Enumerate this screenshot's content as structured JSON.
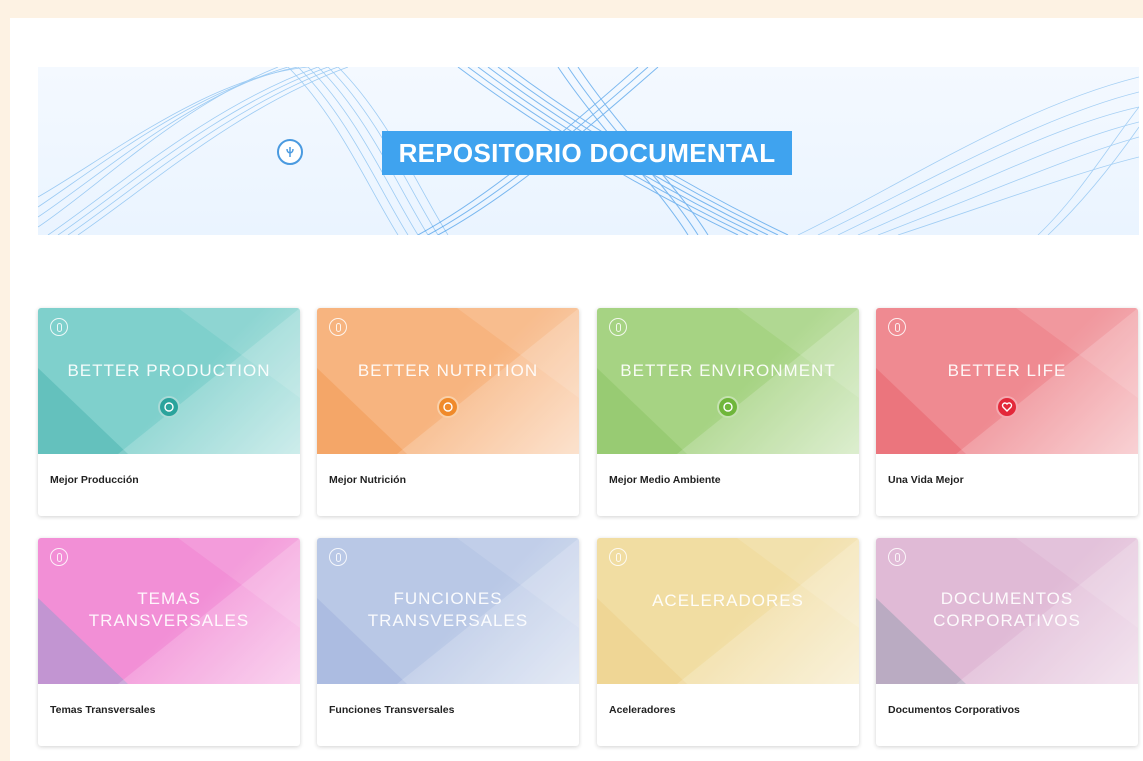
{
  "banner": {
    "title": "REPOSITORIO DOCUMENTAL",
    "logo_icon": "fao-logo-icon",
    "accent_color": "#3fa3ef"
  },
  "cards": [
    {
      "key": "production",
      "heading_lines": [
        "BETTER PRODUCTION"
      ],
      "caption": "Mejor Producción",
      "color": "#7fd0cc",
      "dark": "#4fb5b0",
      "badge_color": "#2aa39c",
      "badge_icon": "leaf-icon"
    },
    {
      "key": "nutrition",
      "heading_lines": [
        "BETTER NUTRITION"
      ],
      "caption": "Mejor Nutrición",
      "color": "#f7b47f",
      "dark": "#f29a55",
      "badge_color": "#f08a2a",
      "badge_icon": "bowl-icon"
    },
    {
      "key": "environment",
      "heading_lines": [
        "BETTER ENVIRONMENT"
      ],
      "caption": "Mejor Medio Ambiente",
      "color": "#a6d383",
      "dark": "#8cc466",
      "badge_color": "#6fb63a",
      "badge_icon": "globe-icon"
    },
    {
      "key": "life",
      "heading_lines": [
        "BETTER LIFE"
      ],
      "caption": "Una Vida Mejor",
      "color": "#ef8a91",
      "dark": "#e8646e",
      "badge_color": "#e3283a",
      "badge_icon": "heart-icon"
    },
    {
      "key": "temas",
      "heading_lines": [
        "TEMAS",
        "TRANSVERSALES"
      ],
      "caption": "Temas Transversales",
      "color": "#f28fd6",
      "dark": "#9a9ad0",
      "badge_color": "",
      "badge_icon": ""
    },
    {
      "key": "funciones",
      "heading_lines": [
        "FUNCIONES",
        "TRANSVERSALES"
      ],
      "caption": "Funciones Transversales",
      "color": "#b9c8e6",
      "dark": "#a3b3dc",
      "badge_color": "",
      "badge_icon": ""
    },
    {
      "key": "aceleradores",
      "heading_lines": [
        "ACELERADORES"
      ],
      "caption": "Aceleradores",
      "color": "#f1dda2",
      "dark": "#ecd08a",
      "badge_color": "",
      "badge_icon": ""
    },
    {
      "key": "corporativos",
      "heading_lines": [
        "DOCUMENTOS",
        "CORPORATIVOS"
      ],
      "caption": "Documentos Corporativos",
      "color": "#e0bad6",
      "dark": "#9b9fb3",
      "badge_color": "",
      "badge_icon": ""
    }
  ]
}
